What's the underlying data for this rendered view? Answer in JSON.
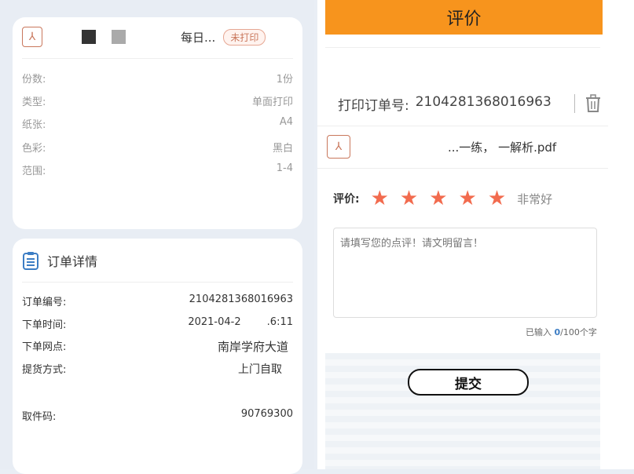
{
  "print_card": {
    "file_name": "每日...",
    "status_badge": "未打印",
    "rows": [
      {
        "label": "份数:",
        "value": "1份"
      },
      {
        "label": "类型:",
        "value": "单面打印"
      },
      {
        "label": "纸张:",
        "value": "A4"
      },
      {
        "label": "色彩:",
        "value": "黑白"
      },
      {
        "label": "范围:",
        "value": "1-4"
      }
    ]
  },
  "order_card": {
    "title": "订单详情",
    "rows": [
      {
        "label": "订单编号:",
        "value": "2104281368016963"
      },
      {
        "label": "下单时间:",
        "value": "2021-04-2        .6:11"
      },
      {
        "label": "下单网点:",
        "value": "南岸学府大道"
      },
      {
        "label": "提货方式:",
        "value": "上门自取"
      },
      {
        "label": "取件码:",
        "value": "90769300"
      }
    ]
  },
  "review": {
    "header_title": "评价",
    "order_no_label": "打印订单号:",
    "order_no": "2104281368016963",
    "file_name": "...一练， 一解析.pdf",
    "rating_label": "评价:",
    "rating_value": 5,
    "rating_max": 5,
    "rating_text": "非常好",
    "comment_placeholder": "请填写您的点评！请文明留言！",
    "char_count_prefix": "已输入 ",
    "char_count": "0",
    "char_count_suffix": "/100个字",
    "submit_label": "提交"
  },
  "colors": {
    "accent_orange": "#f7941d",
    "star": "#f26b4e",
    "pdf_icon": "#c9775c"
  }
}
